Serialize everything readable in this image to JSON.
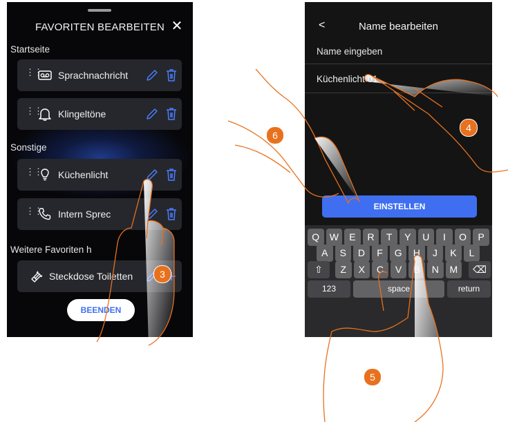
{
  "left_screen": {
    "title": "FAVORITEN BEARBEITEN",
    "section_startseite": "Startseite",
    "section_sonstige": "Sonstige",
    "section_weitere": "Weitere Favoriten h",
    "items": [
      {
        "label": "Sprachnachricht",
        "icon": "voicemail-icon"
      },
      {
        "label": "Klingeltöne",
        "icon": "bell-icon"
      },
      {
        "label": "Küchenlicht",
        "icon": "lightbulb-icon"
      },
      {
        "label": "Intern Sprec",
        "icon": "phone-icon"
      },
      {
        "label": "Steckdose Toiletten",
        "icon": "plug-icon"
      }
    ],
    "finish_button": "BEENDEN"
  },
  "right_screen": {
    "title": "Name bearbeiten",
    "field_label": "Name eingeben",
    "field_value": "Küchenlicht 01",
    "set_button": "EINSTELLEN",
    "keyboard": {
      "row1": [
        "Q",
        "W",
        "E",
        "R",
        "T",
        "Y",
        "U",
        "I",
        "O",
        "P"
      ],
      "row2": [
        "A",
        "S",
        "D",
        "F",
        "G",
        "H",
        "J",
        "K",
        "L"
      ],
      "row3": [
        "Z",
        "X",
        "C",
        "V",
        "B",
        "N",
        "M"
      ],
      "numbers_key": "123",
      "space_key": "space",
      "return_key": "return"
    }
  },
  "step_badges": [
    "3",
    "4",
    "5",
    "6"
  ],
  "colors": {
    "accent": "#3f6ff0",
    "badge": "#e8711e",
    "icon_blue": "#4a7dff"
  }
}
